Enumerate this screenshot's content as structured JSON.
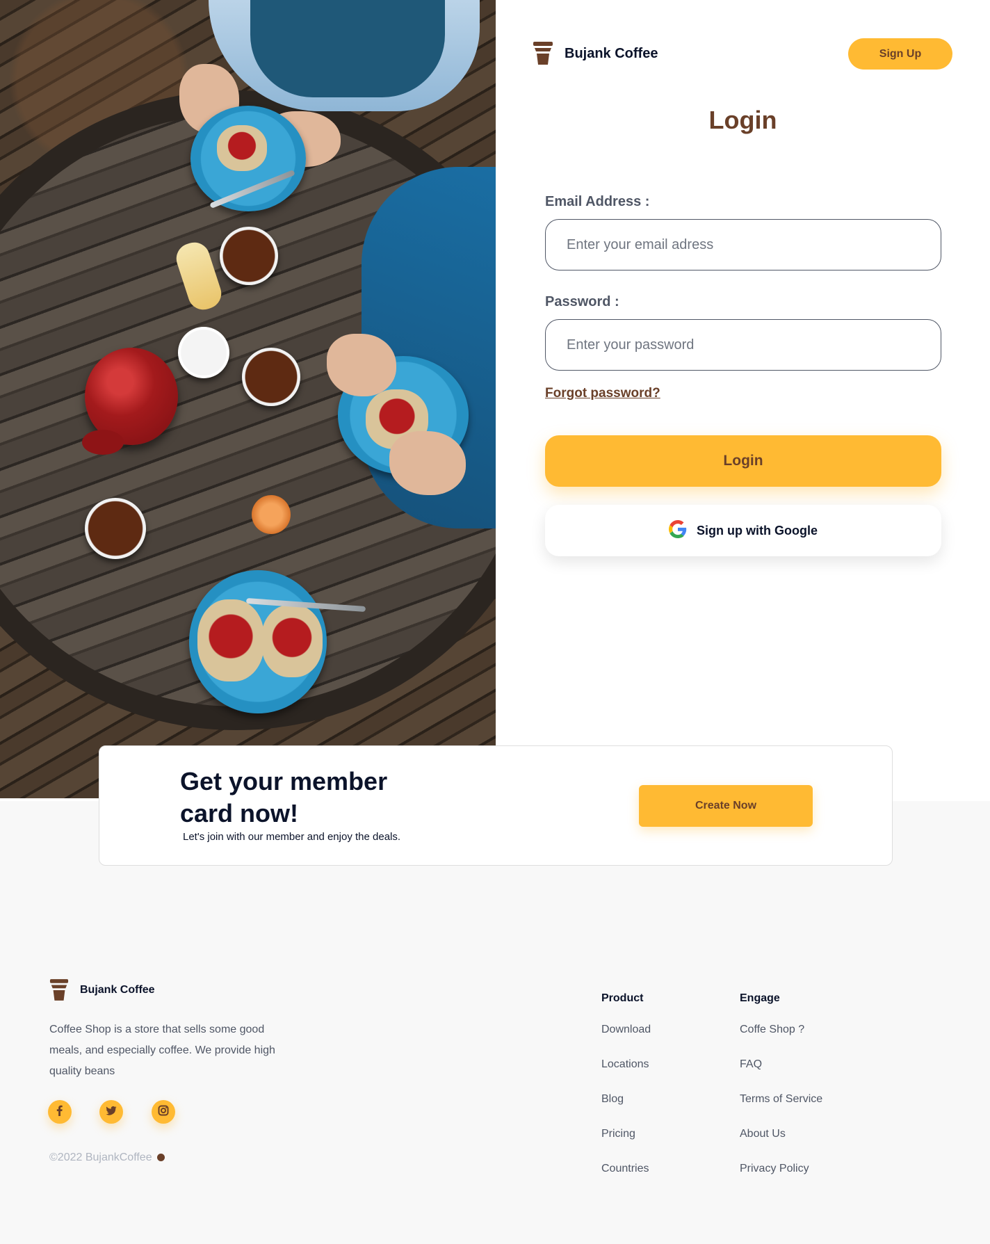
{
  "brand": {
    "name": "Bujank Coffee"
  },
  "header": {
    "signup_label": "Sign Up"
  },
  "login": {
    "title": "Login",
    "email_label": "Email Address :",
    "email_placeholder": "Enter your email adress",
    "password_label": "Password :",
    "password_placeholder": "Enter your password",
    "forgot_label": "Forgot password?",
    "submit_label": "Login",
    "google_label": "Sign up with Google"
  },
  "member": {
    "title": "Get your member card now!",
    "subtitle": "Let's join with our member and enjoy the deals.",
    "cta_label": "Create Now"
  },
  "footer": {
    "brand": "Bujank Coffee",
    "description": "Coffee Shop is a store that sells some good meals, and especially coffee. We provide high quality beans",
    "social": [
      "facebook-icon",
      "twitter-icon",
      "instagram-icon"
    ],
    "copyright": "©2022 BujankCoffee",
    "columns": [
      {
        "heading": "Product",
        "links": [
          "Download",
          "Locations",
          "Blog",
          "Pricing",
          "Countries"
        ]
      },
      {
        "heading": "Engage",
        "links": [
          "Coffe Shop ?",
          "FAQ",
          "Terms of Service",
          "About Us",
          "Privacy Policy"
        ]
      }
    ]
  },
  "colors": {
    "accent": "#ffba33",
    "brown": "#6a4029",
    "ink": "#0b132a",
    "muted": "#4f5665",
    "footer_bg": "#f8f8f8"
  }
}
